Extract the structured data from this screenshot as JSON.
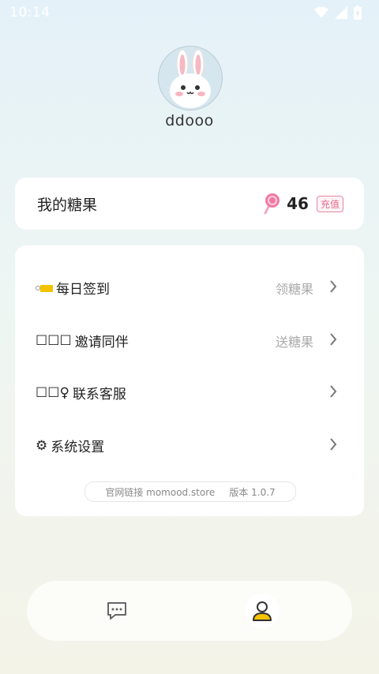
{
  "status_bar": {
    "time": "10:14"
  },
  "profile": {
    "username": "ddooo"
  },
  "candy": {
    "title": "我的糖果",
    "count": "46",
    "recharge_label": "充值"
  },
  "menu": {
    "items": [
      {
        "prefix": "",
        "label": "每日签到",
        "hint": "领糖果"
      },
      {
        "prefix": "☐☐☐",
        "label": "邀请同伴",
        "hint": "送糖果"
      },
      {
        "prefix": "☐☐♀",
        "label": "联系客服",
        "hint": ""
      },
      {
        "prefix": "⚙",
        "label": "系统设置",
        "hint": ""
      }
    ],
    "footer_site": "官网链接 momood.store",
    "footer_version": "版本 1.0.7"
  },
  "nav": {
    "icons": [
      "chat-bubble-icon",
      "person-icon"
    ]
  },
  "colors": {
    "accent_pink": "#e06a8c",
    "tag_yellow": "#f5c200"
  }
}
